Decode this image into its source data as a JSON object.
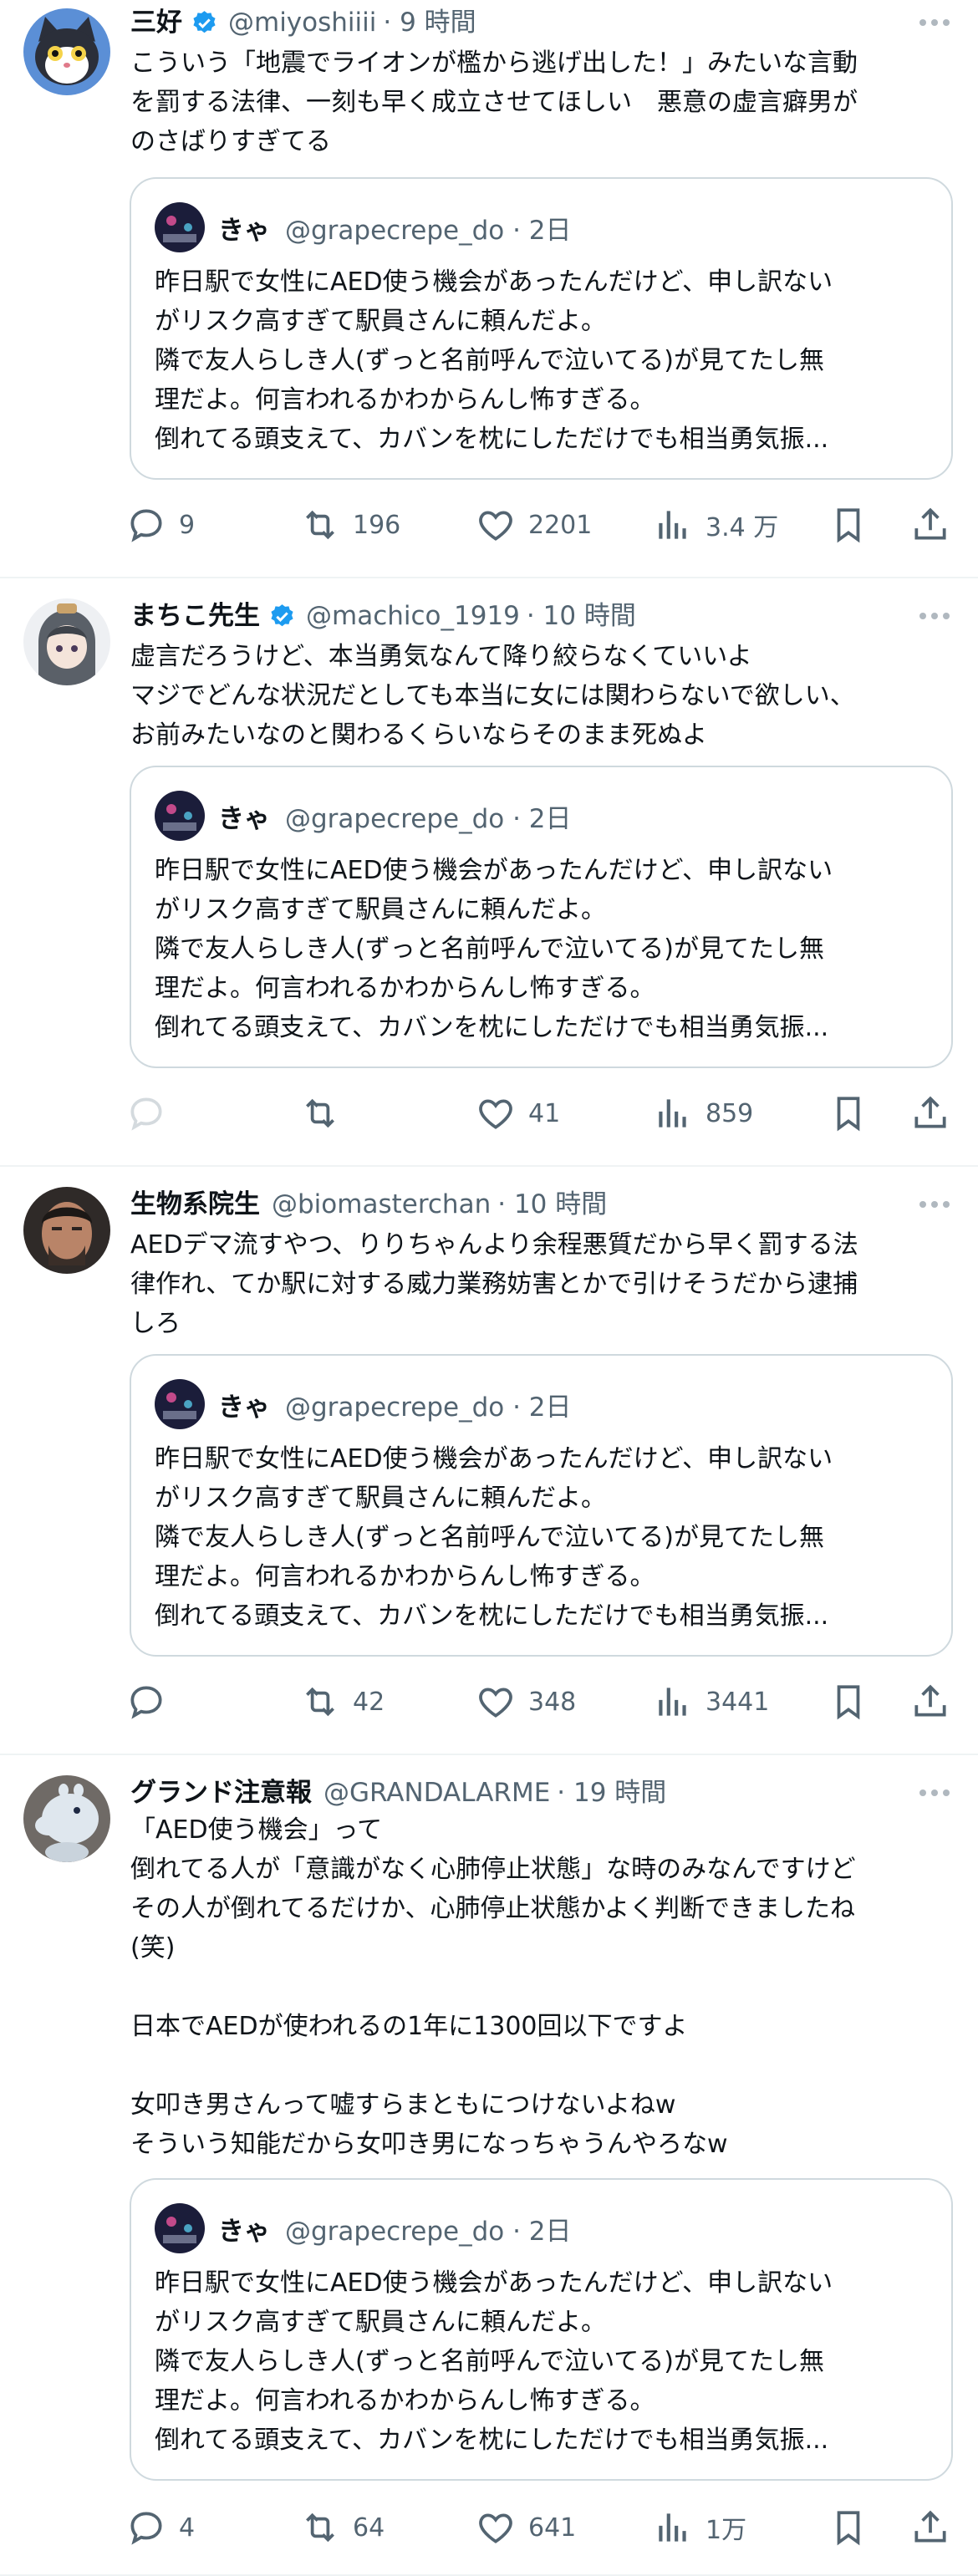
{
  "tweets": [
    {
      "name": "三好",
      "verified": true,
      "handle": "@miyoshiiii",
      "time": "· 9 時間",
      "avatar_icon": "cat-avatar-icon",
      "lines": [
        "こういう「地震でライオンが檻から逃げ出した！」みたいな言動",
        "を罰する法律、一刻も早く成立させてほしい　悪意の虚言癖男が",
        "のさばりすぎてる"
      ],
      "quote": {
        "name": "きゃ",
        "meta": "@grapecrepe_do · 2日",
        "lines": [
          "昨日駅で女性にAED使う機会があったんだけど、申し訳ない",
          "がリスク高すぎて駅員さんに頼んだよ。",
          "隣で友人らしき人(ずっと名前呼んで泣いてる)が見てたし無",
          "理だよ。何言われるかわからんし怖すぎる。",
          "倒れてる頭支えて、カバンを枕にしただけでも相当勇気振..."
        ]
      },
      "replies": "9",
      "reposts": "196",
      "likes": "2201",
      "views": "3.4 万"
    },
    {
      "name": "まちこ先生",
      "verified": true,
      "handle": "@machico_1919",
      "time": "· 10 時間",
      "avatar_icon": "anime-girl-avatar-icon",
      "lines": [
        "虚言だろうけど、本当勇気なんて降り絞らなくていいよ",
        "マジでどんな状況だとしても本当に女には関わらないで欲しい、",
        "お前みたいなのと関わるくらいならそのまま死ぬよ"
      ],
      "quote": {
        "name": "きゃ",
        "meta": "@grapecrepe_do · 2日",
        "lines": [
          "昨日駅で女性にAED使う機会があったんだけど、申し訳ない",
          "がリスク高すぎて駅員さんに頼んだよ。",
          "隣で友人らしき人(ずっと名前呼んで泣いてる)が見てたし無",
          "理だよ。何言われるかわからんし怖すぎる。",
          "倒れてる頭支えて、カバンを枕にしただけでも相当勇気振..."
        ]
      },
      "replies": "",
      "reposts": "",
      "likes": "41",
      "views": "859"
    },
    {
      "name": "生物系院生",
      "verified": false,
      "handle": "@biomasterchan",
      "time": "· 10 時間",
      "avatar_icon": "man-photo-avatar-icon",
      "lines": [
        "AEDデマ流すやつ、りりちゃんより余程悪質だから早く罰する法",
        "律作れ、てか駅に対する威力業務妨害とかで引けそうだから逮捕",
        "しろ"
      ],
      "quote": {
        "name": "きゃ",
        "meta": "@grapecrepe_do · 2日",
        "lines": [
          "昨日駅で女性にAED使う機会があったんだけど、申し訳ない",
          "がリスク高すぎて駅員さんに頼んだよ。",
          "隣で友人らしき人(ずっと名前呼んで泣いてる)が見てたし無",
          "理だよ。何言われるかわからんし怖すぎる。",
          "倒れてる頭支えて、カバンを枕にしただけでも相当勇気振..."
        ]
      },
      "replies": "",
      "reposts": "42",
      "likes": "348",
      "views": "3441"
    },
    {
      "name": "グランド注意報",
      "verified": false,
      "handle": "@GRANDALARME",
      "time": "· 19 時間",
      "avatar_icon": "moomin-avatar-icon",
      "lines": [
        "「AED使う機会」って",
        "倒れてる人が「意識がなく心肺停止状態」な時のみなんですけど",
        "その人が倒れてるだけか、心肺停止状態かよく判断できましたね",
        "(笑)",
        "",
        "日本でAEDが使われるの1年に1300回以下ですよ",
        "",
        "女叩き男さんって嘘すらまともにつけないよねw",
        "そういう知能だから女叩き男になっちゃうんやろなw"
      ],
      "quote": {
        "name": "きゃ",
        "meta": "@grapecrepe_do · 2日",
        "lines": [
          "昨日駅で女性にAED使う機会があったんだけど、申し訳ない",
          "がリスク高すぎて駅員さんに頼んだよ。",
          "隣で友人らしき人(ずっと名前呼んで泣いてる)が見てたし無",
          "理だよ。何言われるかわからんし怖すぎる。",
          "倒れてる頭支えて、カバンを枕にしただけでも相当勇気振..."
        ]
      },
      "replies": "4",
      "reposts": "64",
      "likes": "641",
      "views": "1万"
    }
  ],
  "colors": {
    "text": "#0f1419",
    "secondary": "#536471",
    "verified": "#1d9bf0",
    "border": "#cfd9de"
  }
}
